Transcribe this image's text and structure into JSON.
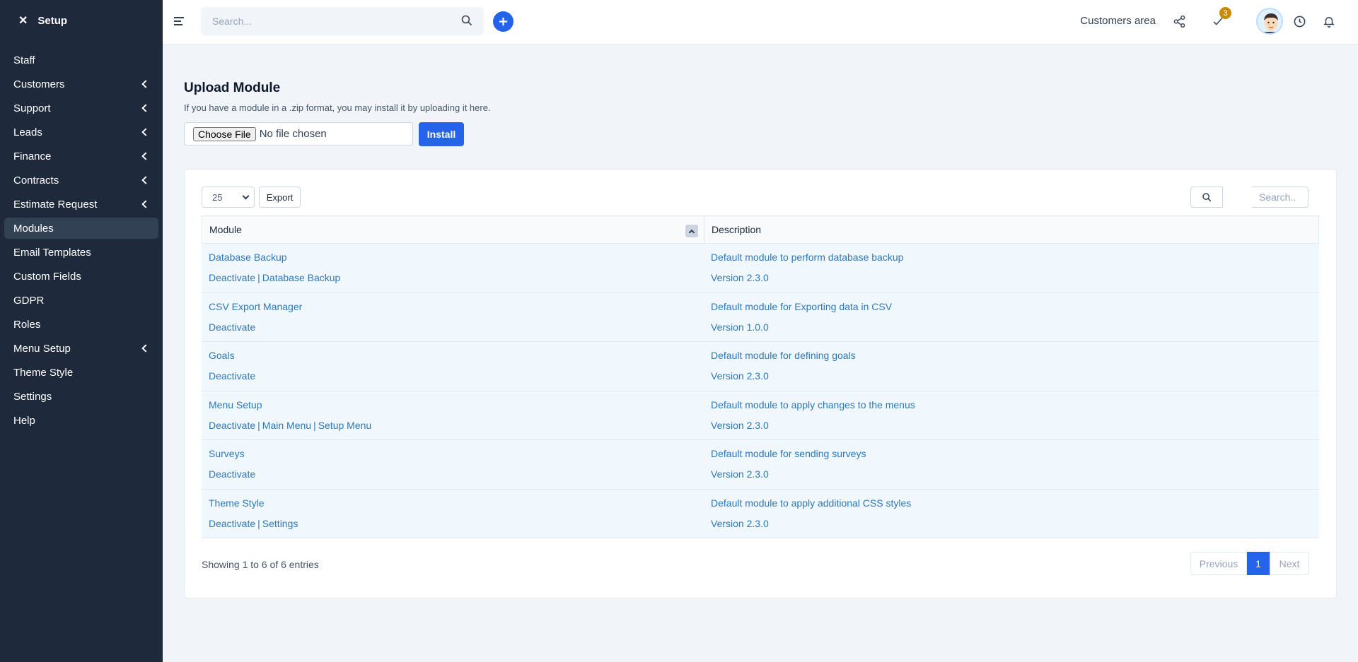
{
  "sidebar": {
    "title": "Setup",
    "close_glyph": "✕",
    "items": [
      {
        "label": "Staff",
        "submenu": false
      },
      {
        "label": "Customers",
        "submenu": true
      },
      {
        "label": "Support",
        "submenu": true
      },
      {
        "label": "Leads",
        "submenu": true
      },
      {
        "label": "Finance",
        "submenu": true
      },
      {
        "label": "Contracts",
        "submenu": true
      },
      {
        "label": "Estimate Request",
        "submenu": true
      },
      {
        "label": "Modules",
        "submenu": false,
        "active": true
      },
      {
        "label": "Email Templates",
        "submenu": false
      },
      {
        "label": "Custom Fields",
        "submenu": false
      },
      {
        "label": "GDPR",
        "submenu": false
      },
      {
        "label": "Roles",
        "submenu": false
      },
      {
        "label": "Menu Setup",
        "submenu": true
      },
      {
        "label": "Theme Style",
        "submenu": false
      },
      {
        "label": "Settings",
        "submenu": false
      },
      {
        "label": "Help",
        "submenu": false
      }
    ]
  },
  "topbar": {
    "search_placeholder": "Search...",
    "customers_area": "Customers area",
    "tasks_badge": "3",
    "icons": [
      "menu-icon",
      "search-icon",
      "plus-icon",
      "share-icon",
      "check-icon",
      "clock-icon",
      "bell-icon"
    ]
  },
  "upload": {
    "title": "Upload Module",
    "description": "If you have a module in a .zip format, you may install it by uploading it here.",
    "choose_file": "Choose File",
    "no_file": "No file chosen",
    "install": "Install"
  },
  "table": {
    "page_length": "25",
    "export": "Export",
    "search_placeholder": "Search..",
    "columns": [
      "Module",
      "Description"
    ],
    "rows": [
      {
        "name": "Database Backup",
        "actions": [
          "Deactivate",
          "Database Backup"
        ],
        "description": "Default module to perform database backup",
        "version": "Version 2.3.0"
      },
      {
        "name": "CSV Export Manager",
        "actions": [
          "Deactivate"
        ],
        "description": "Default module for Exporting data in CSV",
        "version": "Version 1.0.0"
      },
      {
        "name": "Goals",
        "actions": [
          "Deactivate"
        ],
        "description": "Default module for defining goals",
        "version": "Version 2.3.0"
      },
      {
        "name": "Menu Setup",
        "actions": [
          "Deactivate",
          "Main Menu",
          "Setup Menu"
        ],
        "description": "Default module to apply changes to the menus",
        "version": "Version 2.3.0"
      },
      {
        "name": "Surveys",
        "actions": [
          "Deactivate"
        ],
        "description": "Default module for sending surveys",
        "version": "Version 2.3.0"
      },
      {
        "name": "Theme Style",
        "actions": [
          "Deactivate",
          "Settings"
        ],
        "description": "Default module to apply additional CSS styles",
        "version": "Version 2.3.0"
      }
    ],
    "info": "Showing 1 to 6 of 6 entries",
    "pagination": {
      "previous": "Previous",
      "current": "1",
      "next": "Next"
    }
  },
  "colors": {
    "sidebar_bg": "#1e293b",
    "accent": "#2563eb",
    "link": "#2e78b7",
    "badge": "#ca8a04"
  }
}
